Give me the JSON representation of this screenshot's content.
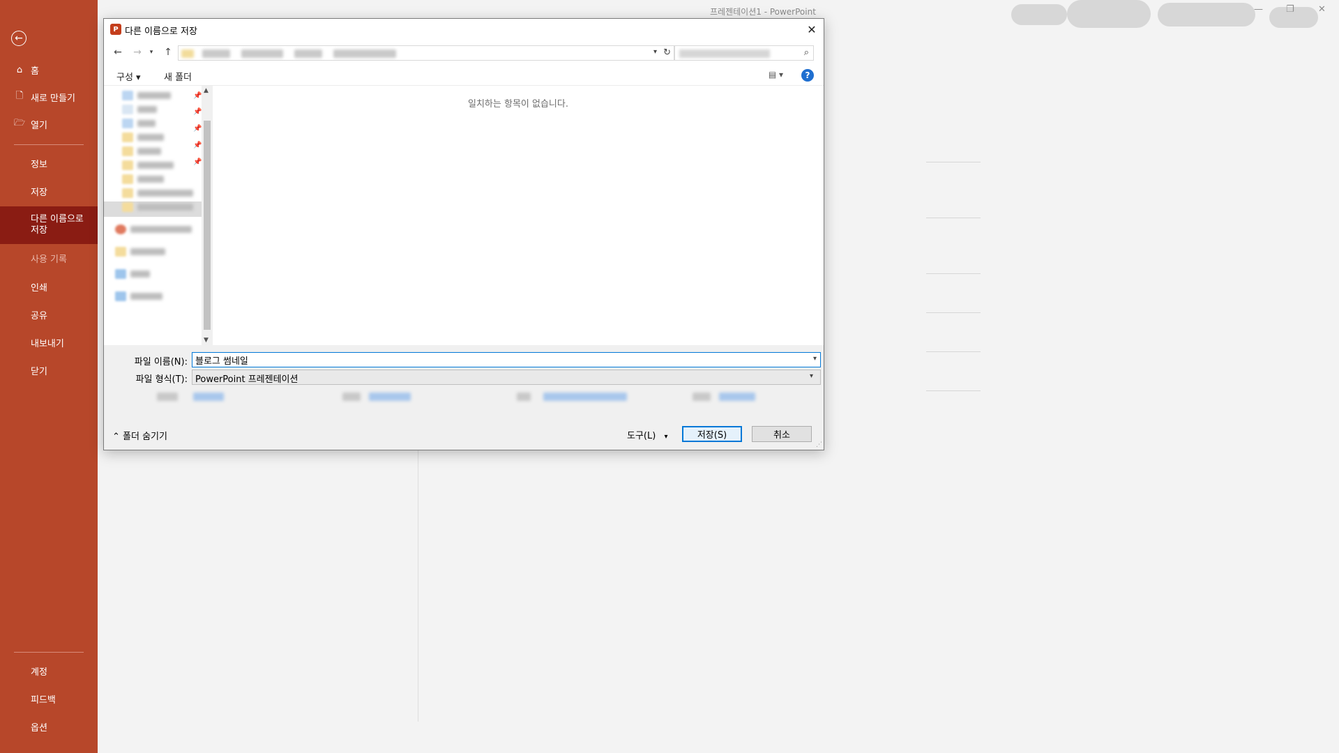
{
  "window": {
    "title": "프레젠테이션1  -  PowerPoint"
  },
  "backstage_nav": {
    "back_icon": "arrow-left-icon",
    "items": [
      {
        "label": "홈",
        "icon": "home-icon"
      },
      {
        "label": "새로 만들기",
        "icon": "new-document-icon"
      },
      {
        "label": "열기",
        "icon": "open-folder-icon"
      },
      {
        "label": "정보"
      },
      {
        "label": "저장"
      },
      {
        "label": "다른 이름으로 저장",
        "active": true
      },
      {
        "label": "사용 기록",
        "disabled": true
      },
      {
        "label": "인쇄"
      },
      {
        "label": "공유"
      },
      {
        "label": "내보내기"
      },
      {
        "label": "닫기"
      },
      {
        "label": "계정"
      },
      {
        "label": "피드백"
      },
      {
        "label": "옵션"
      }
    ],
    "colors": {
      "background": "#b7472a",
      "active": "#8a1c13"
    }
  },
  "dialog": {
    "title": "다른 이름으로 저장",
    "app_icon_letter": "P",
    "toolbar": {
      "organize_label": "구성 ▾",
      "new_folder_label": "새 폴더"
    },
    "empty_message": "일치하는 항목이 없습니다.",
    "file_name_label": "파일 이름(N):",
    "file_name_value": "블로그 썸네일",
    "file_type_label": "파일 형식(T):",
    "file_type_value": "PowerPoint 프레젠테이션",
    "hide_folders_label": "폴더 숨기기",
    "tools_label": "도구(L)",
    "save_label": "저장(S)",
    "cancel_label": "취소",
    "colors": {
      "accent": "#0078d7",
      "help": "#1f6fd0"
    }
  }
}
